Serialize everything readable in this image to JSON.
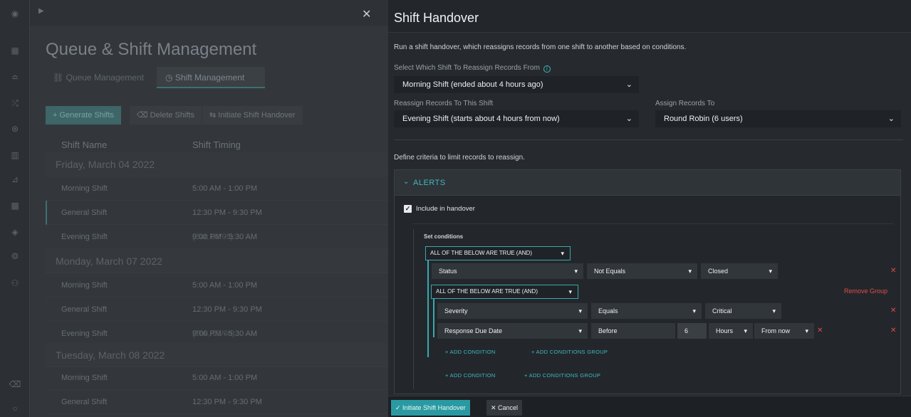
{
  "background": {
    "title": "Queue & Shift Management",
    "tabs": [
      {
        "label": "Queue Management",
        "icon": "queue-icon"
      },
      {
        "label": "Shift Management",
        "icon": "clock-icon"
      }
    ],
    "actions": {
      "generate": "+ Generate Shifts",
      "delete": "Delete Shifts",
      "handover": "Initiate Shift Handover"
    },
    "columns": {
      "name": "Shift Name",
      "timing": "Shift Timing"
    },
    "dates": [
      "Friday, March 04 2022",
      "Monday, March 07 2022",
      "Tuesday, March 08 2022"
    ],
    "rows": [
      {
        "name": "Morning Shift",
        "timing": "5:00 AM - 1:00 PM",
        "extra": ""
      },
      {
        "name": "General Shift",
        "timing": "12:30 PM - 9:30 PM",
        "extra": ""
      },
      {
        "name": "Evening Shift",
        "timing": "9:00 PM - 5:30 AM",
        "extra": "(Sat, 03/05)"
      },
      {
        "name": "Morning Shift",
        "timing": "5:00 AM - 1:00 PM",
        "extra": ""
      },
      {
        "name": "General Shift",
        "timing": "12:30 PM - 9:30 PM",
        "extra": ""
      },
      {
        "name": "Evening Shift",
        "timing": "9:00 PM - 5:30 AM",
        "extra": "(Tue, 03/08)"
      },
      {
        "name": "Morning Shift",
        "timing": "5:00 AM - 1:00 PM",
        "extra": ""
      },
      {
        "name": "General Shift",
        "timing": "12:30 PM - 9:30 PM",
        "extra": ""
      }
    ]
  },
  "drawer": {
    "title": "Shift Handover",
    "description": "Run a shift handover, which reassigns records from one shift to another based on conditions.",
    "from_label": "Select Which Shift To Reassign Records From",
    "from_value": "Morning Shift (ended about 4 hours ago)",
    "to_label": "Reassign Records To This Shift",
    "to_value": "Evening Shift (starts about 4 hours from now)",
    "assign_label": "Assign Records To",
    "assign_value": "Round Robin (6 users)",
    "criteria": "Define criteria to limit records to reassign.",
    "panel": {
      "title": "ALERTS",
      "include_label": "Include in handover",
      "set_conditions": "Set conditions",
      "group_label": "ALL OF THE BELOW ARE TRUE (AND)",
      "subgroup_label": "ALL OF THE BELOW ARE TRUE (AND)",
      "remove_group": "Remove Group",
      "conditions": [
        {
          "field": "Status",
          "op": "Not Equals",
          "value": "Closed"
        },
        {
          "field": "Severity",
          "op": "Equals",
          "value": "Critical"
        },
        {
          "field": "Response Due Date",
          "op": "Before",
          "number": "6",
          "unit": "Hours",
          "ref": "From now"
        }
      ],
      "add_condition": "+ ADD CONDITION",
      "add_group": "+ ADD CONDITIONS GROUP"
    },
    "footer": {
      "initiate": "✓ Initiate Shift Handover",
      "cancel": "✕ Cancel"
    }
  },
  "colors": {
    "accent": "#3fb9c0",
    "danger": "#e04c4c",
    "drawer_bg": "#262a2e"
  }
}
